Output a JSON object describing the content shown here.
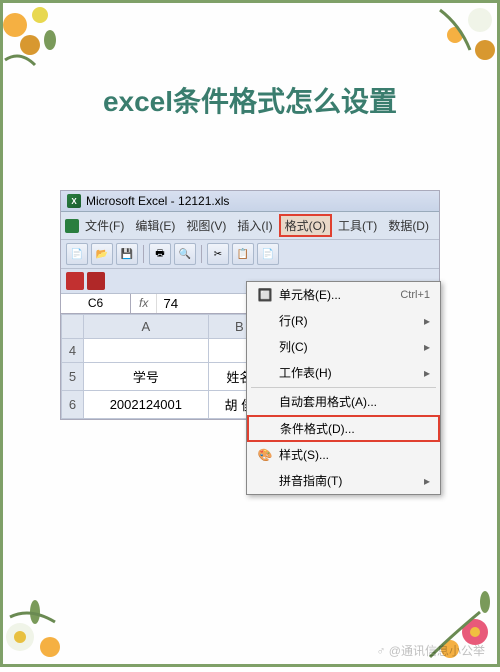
{
  "page_title": "excel条件格式怎么设置",
  "window": {
    "title": "Microsoft Excel - 12121.xls"
  },
  "menubar": {
    "file": "文件(F)",
    "edit": "编辑(E)",
    "view": "视图(V)",
    "insert": "插入(I)",
    "format": "格式(O)",
    "tools": "工具(T)",
    "data": "数据(D)"
  },
  "formula": {
    "cell_ref": "C6",
    "fx": "fx",
    "value": "74"
  },
  "columns": {
    "a": "A",
    "b": "B"
  },
  "rows": {
    "r4": "4",
    "r5": "5",
    "r6": "6"
  },
  "cells": {
    "a5": "学号",
    "b5": "姓名",
    "a6": "2002124001",
    "b6": "胡 俊"
  },
  "dropdown": {
    "cells": "单元格(E)...",
    "cells_shortcut": "Ctrl+1",
    "row": "行(R)",
    "column": "列(C)",
    "sheet": "工作表(H)",
    "autoformat": "自动套用格式(A)...",
    "conditional": "条件格式(D)...",
    "style": "样式(S)...",
    "phonetic": "拼音指南(T)"
  },
  "watermark": "♂ @通讯信息小公举"
}
